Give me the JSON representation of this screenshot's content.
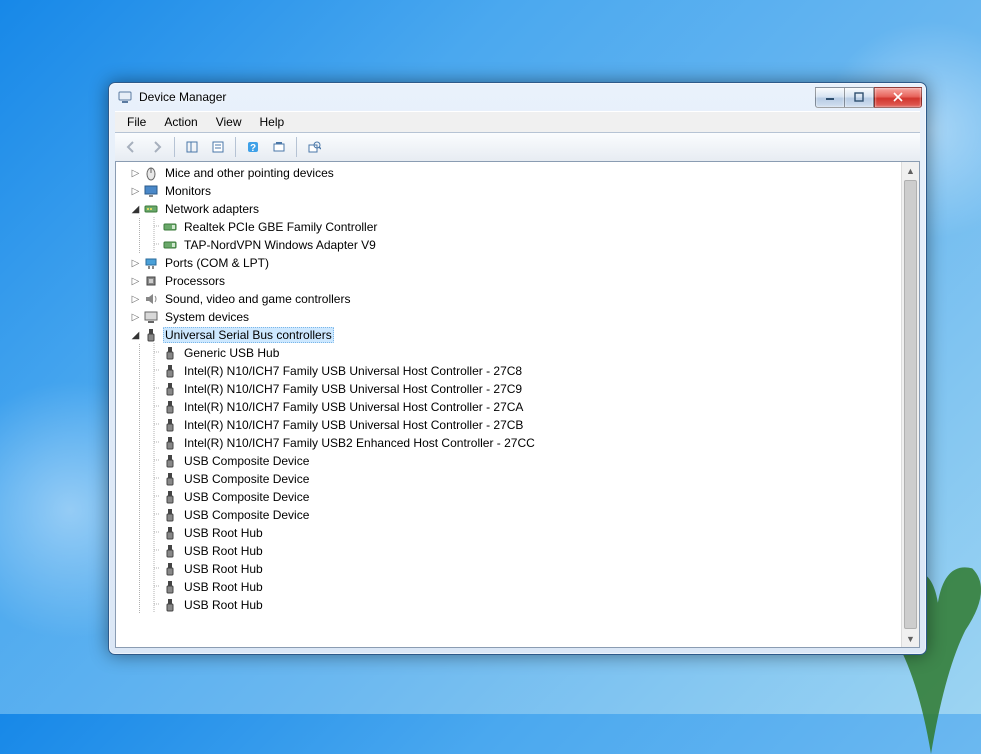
{
  "window": {
    "title": "Device Manager"
  },
  "menu": {
    "file": "File",
    "action": "Action",
    "view": "View",
    "help": "Help"
  },
  "tree": [
    {
      "level": 1,
      "toggle": "closed",
      "icon": "mouse-icon",
      "label": "Mice and other pointing devices"
    },
    {
      "level": 1,
      "toggle": "closed",
      "icon": "monitor-icon",
      "label": "Monitors"
    },
    {
      "level": 1,
      "toggle": "open",
      "icon": "network-icon",
      "label": "Network adapters"
    },
    {
      "level": 2,
      "toggle": "none",
      "icon": "nic-icon",
      "label": "Realtek PCIe GBE Family Controller"
    },
    {
      "level": 2,
      "toggle": "none",
      "icon": "nic-icon",
      "label": "TAP-NordVPN Windows Adapter V9"
    },
    {
      "level": 1,
      "toggle": "closed",
      "icon": "port-icon",
      "label": "Ports (COM & LPT)"
    },
    {
      "level": 1,
      "toggle": "closed",
      "icon": "cpu-icon",
      "label": "Processors"
    },
    {
      "level": 1,
      "toggle": "closed",
      "icon": "sound-icon",
      "label": "Sound, video and game controllers"
    },
    {
      "level": 1,
      "toggle": "closed",
      "icon": "system-icon",
      "label": "System devices"
    },
    {
      "level": 1,
      "toggle": "open",
      "icon": "usb-icon",
      "label": "Universal Serial Bus controllers",
      "selected": true
    },
    {
      "level": 2,
      "toggle": "none",
      "icon": "usb-icon",
      "label": "Generic USB Hub"
    },
    {
      "level": 2,
      "toggle": "none",
      "icon": "usb-icon",
      "label": "Intel(R) N10/ICH7 Family USB Universal Host Controller - 27C8"
    },
    {
      "level": 2,
      "toggle": "none",
      "icon": "usb-icon",
      "label": "Intel(R) N10/ICH7 Family USB Universal Host Controller - 27C9"
    },
    {
      "level": 2,
      "toggle": "none",
      "icon": "usb-icon",
      "label": "Intel(R) N10/ICH7 Family USB Universal Host Controller - 27CA"
    },
    {
      "level": 2,
      "toggle": "none",
      "icon": "usb-icon",
      "label": "Intel(R) N10/ICH7 Family USB Universal Host Controller - 27CB"
    },
    {
      "level": 2,
      "toggle": "none",
      "icon": "usb-icon",
      "label": "Intel(R) N10/ICH7 Family USB2 Enhanced Host Controller - 27CC"
    },
    {
      "level": 2,
      "toggle": "none",
      "icon": "usb-icon",
      "label": "USB Composite Device"
    },
    {
      "level": 2,
      "toggle": "none",
      "icon": "usb-icon",
      "label": "USB Composite Device"
    },
    {
      "level": 2,
      "toggle": "none",
      "icon": "usb-icon",
      "label": "USB Composite Device"
    },
    {
      "level": 2,
      "toggle": "none",
      "icon": "usb-icon",
      "label": "USB Composite Device"
    },
    {
      "level": 2,
      "toggle": "none",
      "icon": "usb-icon",
      "label": "USB Root Hub"
    },
    {
      "level": 2,
      "toggle": "none",
      "icon": "usb-icon",
      "label": "USB Root Hub"
    },
    {
      "level": 2,
      "toggle": "none",
      "icon": "usb-icon",
      "label": "USB Root Hub"
    },
    {
      "level": 2,
      "toggle": "none",
      "icon": "usb-icon",
      "label": "USB Root Hub"
    },
    {
      "level": 2,
      "toggle": "none",
      "icon": "usb-icon",
      "label": "USB Root Hub"
    }
  ]
}
